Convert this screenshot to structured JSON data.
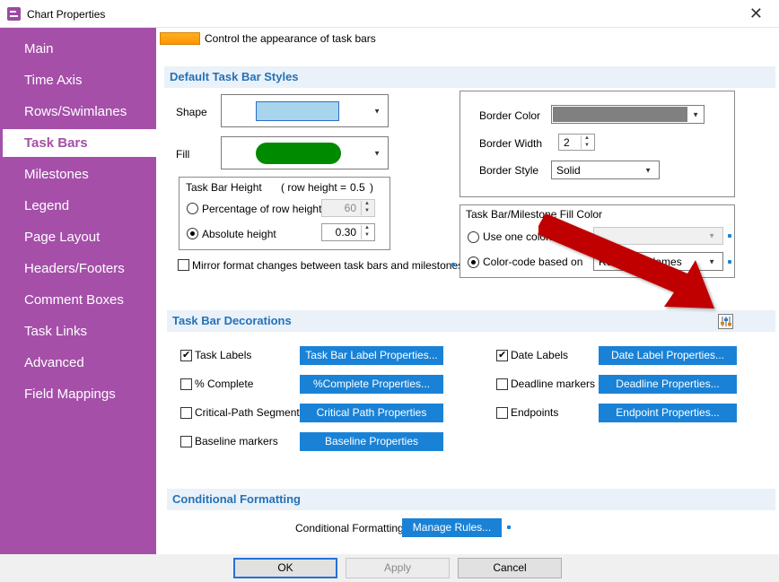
{
  "window": {
    "title": "Chart Properties",
    "close": "✕"
  },
  "sidebar": {
    "items": [
      {
        "label": "Main"
      },
      {
        "label": "Time Axis"
      },
      {
        "label": "Rows/Swimlanes"
      },
      {
        "label": "Task Bars"
      },
      {
        "label": "Milestones"
      },
      {
        "label": "Legend"
      },
      {
        "label": "Page Layout"
      },
      {
        "label": "Headers/Footers"
      },
      {
        "label": "Comment Boxes"
      },
      {
        "label": "Task Links"
      },
      {
        "label": "Advanced"
      },
      {
        "label": "Field Mappings"
      }
    ],
    "active_index": 3
  },
  "header": {
    "description": "Control the appearance of task bars",
    "swatch_color": "#ffa000"
  },
  "default_styles": {
    "title": "Default Task Bar Styles",
    "shape_label": "Shape",
    "shape_color": "#a8d4ec",
    "fill_label": "Fill",
    "fill_color": "#008a00",
    "height_group": {
      "title": "Task Bar Height",
      "row_height_label": "( row height =",
      "row_height_value": "0.5",
      "row_height_close": ")",
      "percentage_label": "Percentage of row height",
      "percentage_value": "60",
      "absolute_label": "Absolute height",
      "absolute_value": "0.30"
    },
    "mirror_label": "Mirror format changes between task bars and milestones",
    "border": {
      "color_label": "Border Color",
      "color": "#808080",
      "width_label": "Border Width",
      "width_value": "2",
      "style_label": "Border Style",
      "style_value": "Solid"
    },
    "fill_color_group": {
      "title": "Task Bar/Milestone Fill Color",
      "one_color_label": "Use one color:",
      "color_code_label": "Color-code based on",
      "color_code_value": "Resource Names"
    }
  },
  "decorations": {
    "title": "Task Bar Decorations",
    "items": [
      {
        "label": "Task Labels",
        "checked": true,
        "button": "Task Bar Label Properties..."
      },
      {
        "label": "% Complete",
        "checked": false,
        "button": "%Complete Properties..."
      },
      {
        "label": "Critical-Path Segments",
        "checked": false,
        "button": "Critical Path Properties"
      },
      {
        "label": "Baseline markers",
        "checked": false,
        "button": "Baseline Properties"
      },
      {
        "label": "Date Labels",
        "checked": true,
        "button": "Date Label Properties..."
      },
      {
        "label": "Deadline markers",
        "checked": false,
        "button": "Deadline Properties..."
      },
      {
        "label": "Endpoints",
        "checked": false,
        "button": "Endpoint Properties..."
      }
    ]
  },
  "conditional": {
    "title": "Conditional Formatting",
    "label": "Conditional Formatting",
    "button": "Manage Rules..."
  },
  "footer": {
    "ok": "OK",
    "apply": "Apply",
    "cancel": "Cancel"
  },
  "colors": {
    "accent": "#a54fa9",
    "section_text": "#2472b8",
    "button_blue": "#1a82d6",
    "arrow_red": "#c00000"
  }
}
